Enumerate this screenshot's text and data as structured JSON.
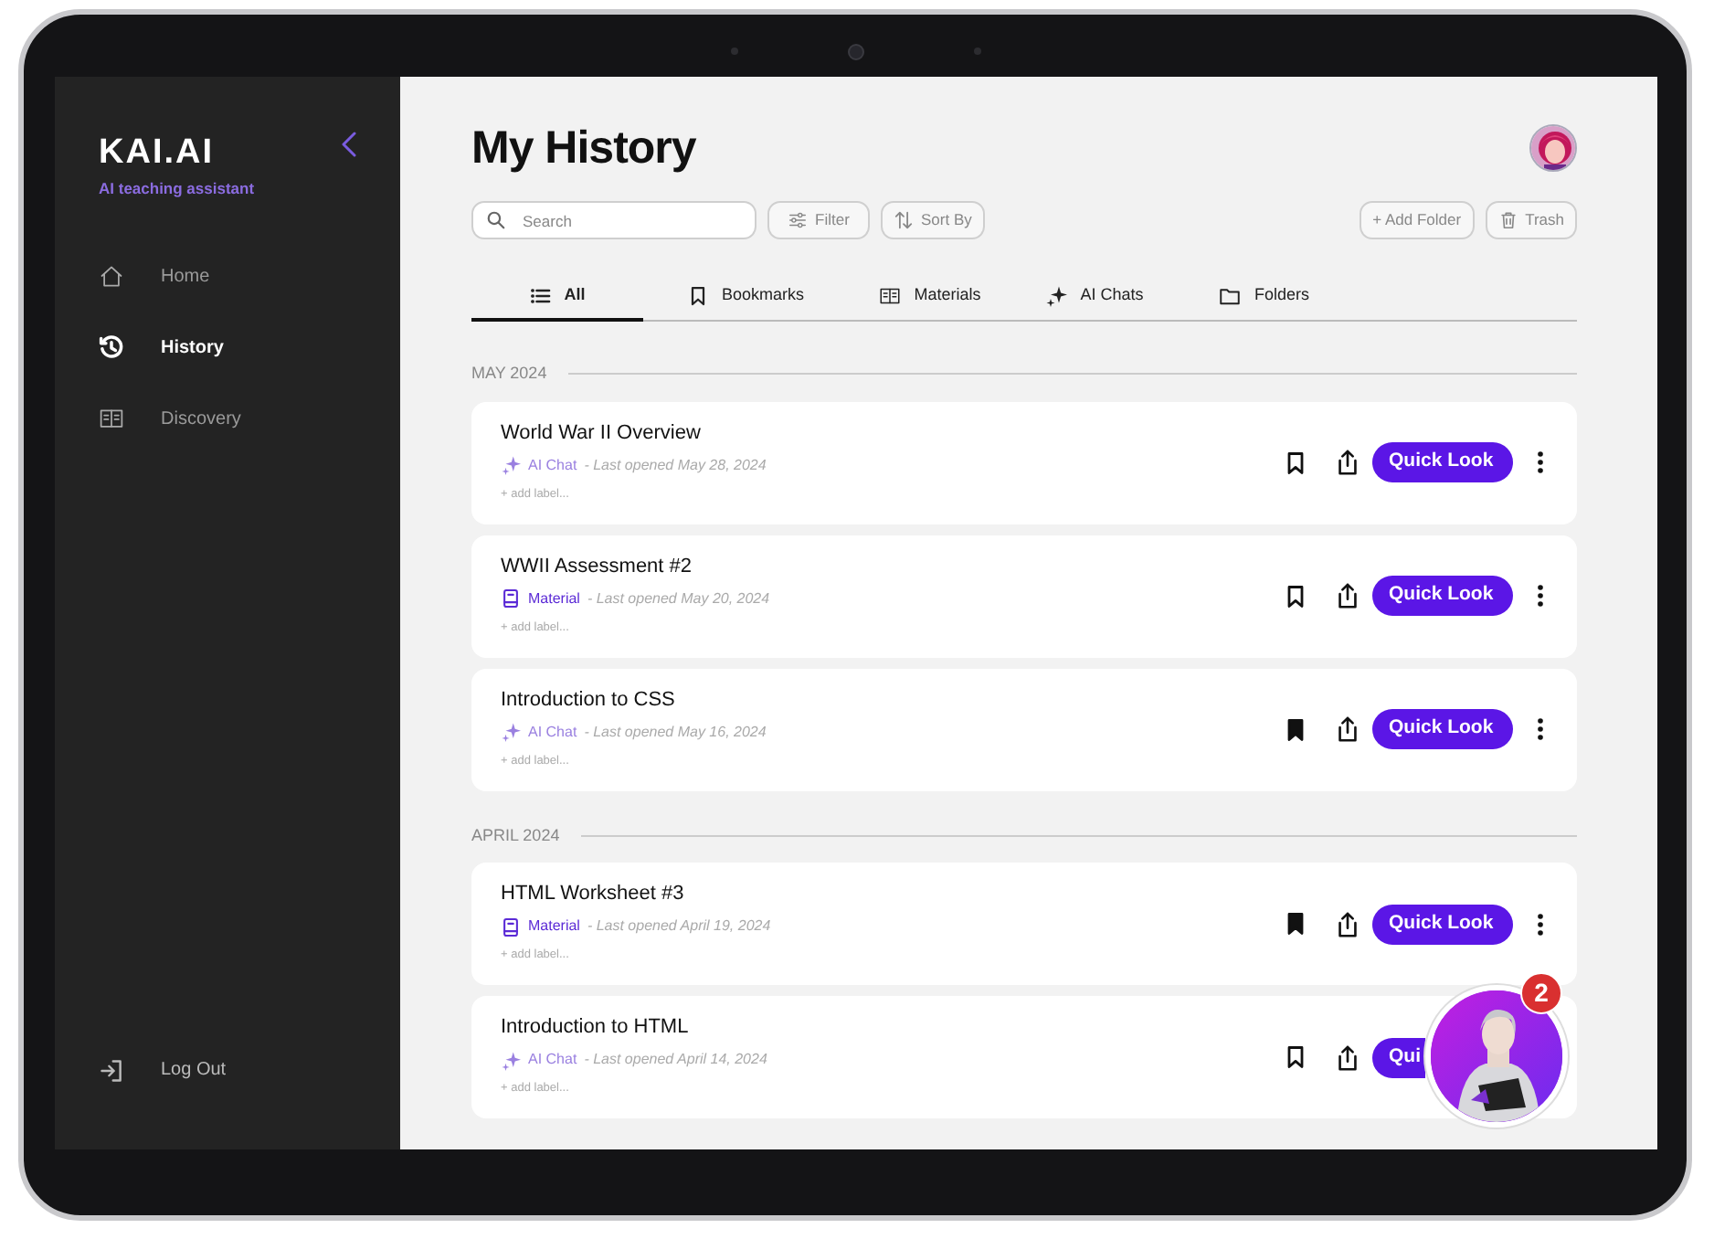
{
  "sidebar": {
    "logo": "KAI.AI",
    "tagline": "AI teaching assistant",
    "items": [
      {
        "label": "Home",
        "kind": "home",
        "selected": false
      },
      {
        "label": "History",
        "kind": "history",
        "selected": true
      },
      {
        "label": "Discovery",
        "kind": "book",
        "selected": false
      }
    ],
    "logout": "Log Out"
  },
  "header": {
    "title": "My History"
  },
  "toolbar": {
    "search": {
      "placeholder": "Search"
    },
    "filter": "Filter",
    "sort": "Sort By",
    "add_folder": "+ Add Folder",
    "trash": "Trash"
  },
  "tabs": [
    {
      "label": "All",
      "kind": "list",
      "selected": true
    },
    {
      "label": "Bookmarks",
      "kind": "bookmark",
      "selected": false
    },
    {
      "label": "Materials",
      "kind": "book",
      "selected": false
    },
    {
      "label": "AI Chats",
      "kind": "sparkle",
      "selected": false
    },
    {
      "label": "Folders",
      "kind": "folder",
      "selected": false
    }
  ],
  "groups": [
    {
      "heading": "MAY 2024",
      "items": [
        {
          "title": "World War II Overview",
          "kind": "chat",
          "type": "AI Chat",
          "opened": "- Last opened May 28, 2024",
          "label_hint": "+ add label...",
          "bookmarked": false,
          "action": "Quick Look"
        },
        {
          "title": "WWII Assessment #2",
          "kind": "material",
          "type": "Material",
          "opened": "- Last opened May 20, 2024",
          "label_hint": "+ add label...",
          "bookmarked": false,
          "action": "Quick Look"
        },
        {
          "title": "Introduction to CSS",
          "kind": "chat",
          "type": "AI Chat",
          "opened": "- Last opened May 16, 2024",
          "label_hint": "+ add label...",
          "bookmarked": true,
          "action": "Quick Look"
        }
      ]
    },
    {
      "heading": "APRIL 2024",
      "items": [
        {
          "title": "HTML Worksheet #3",
          "kind": "material",
          "type": "Material",
          "opened": "- Last opened April 19, 2024",
          "label_hint": "+ add label...",
          "bookmarked": true,
          "action": "Quick Look"
        },
        {
          "title": "Introduction to HTML",
          "kind": "chat",
          "type": "AI Chat",
          "opened": "- Last opened April 14, 2024",
          "label_hint": "+ add label...",
          "bookmarked": false,
          "action": "Qui"
        }
      ]
    }
  ],
  "assistant": {
    "kind": "picture",
    "badge": "2"
  }
}
